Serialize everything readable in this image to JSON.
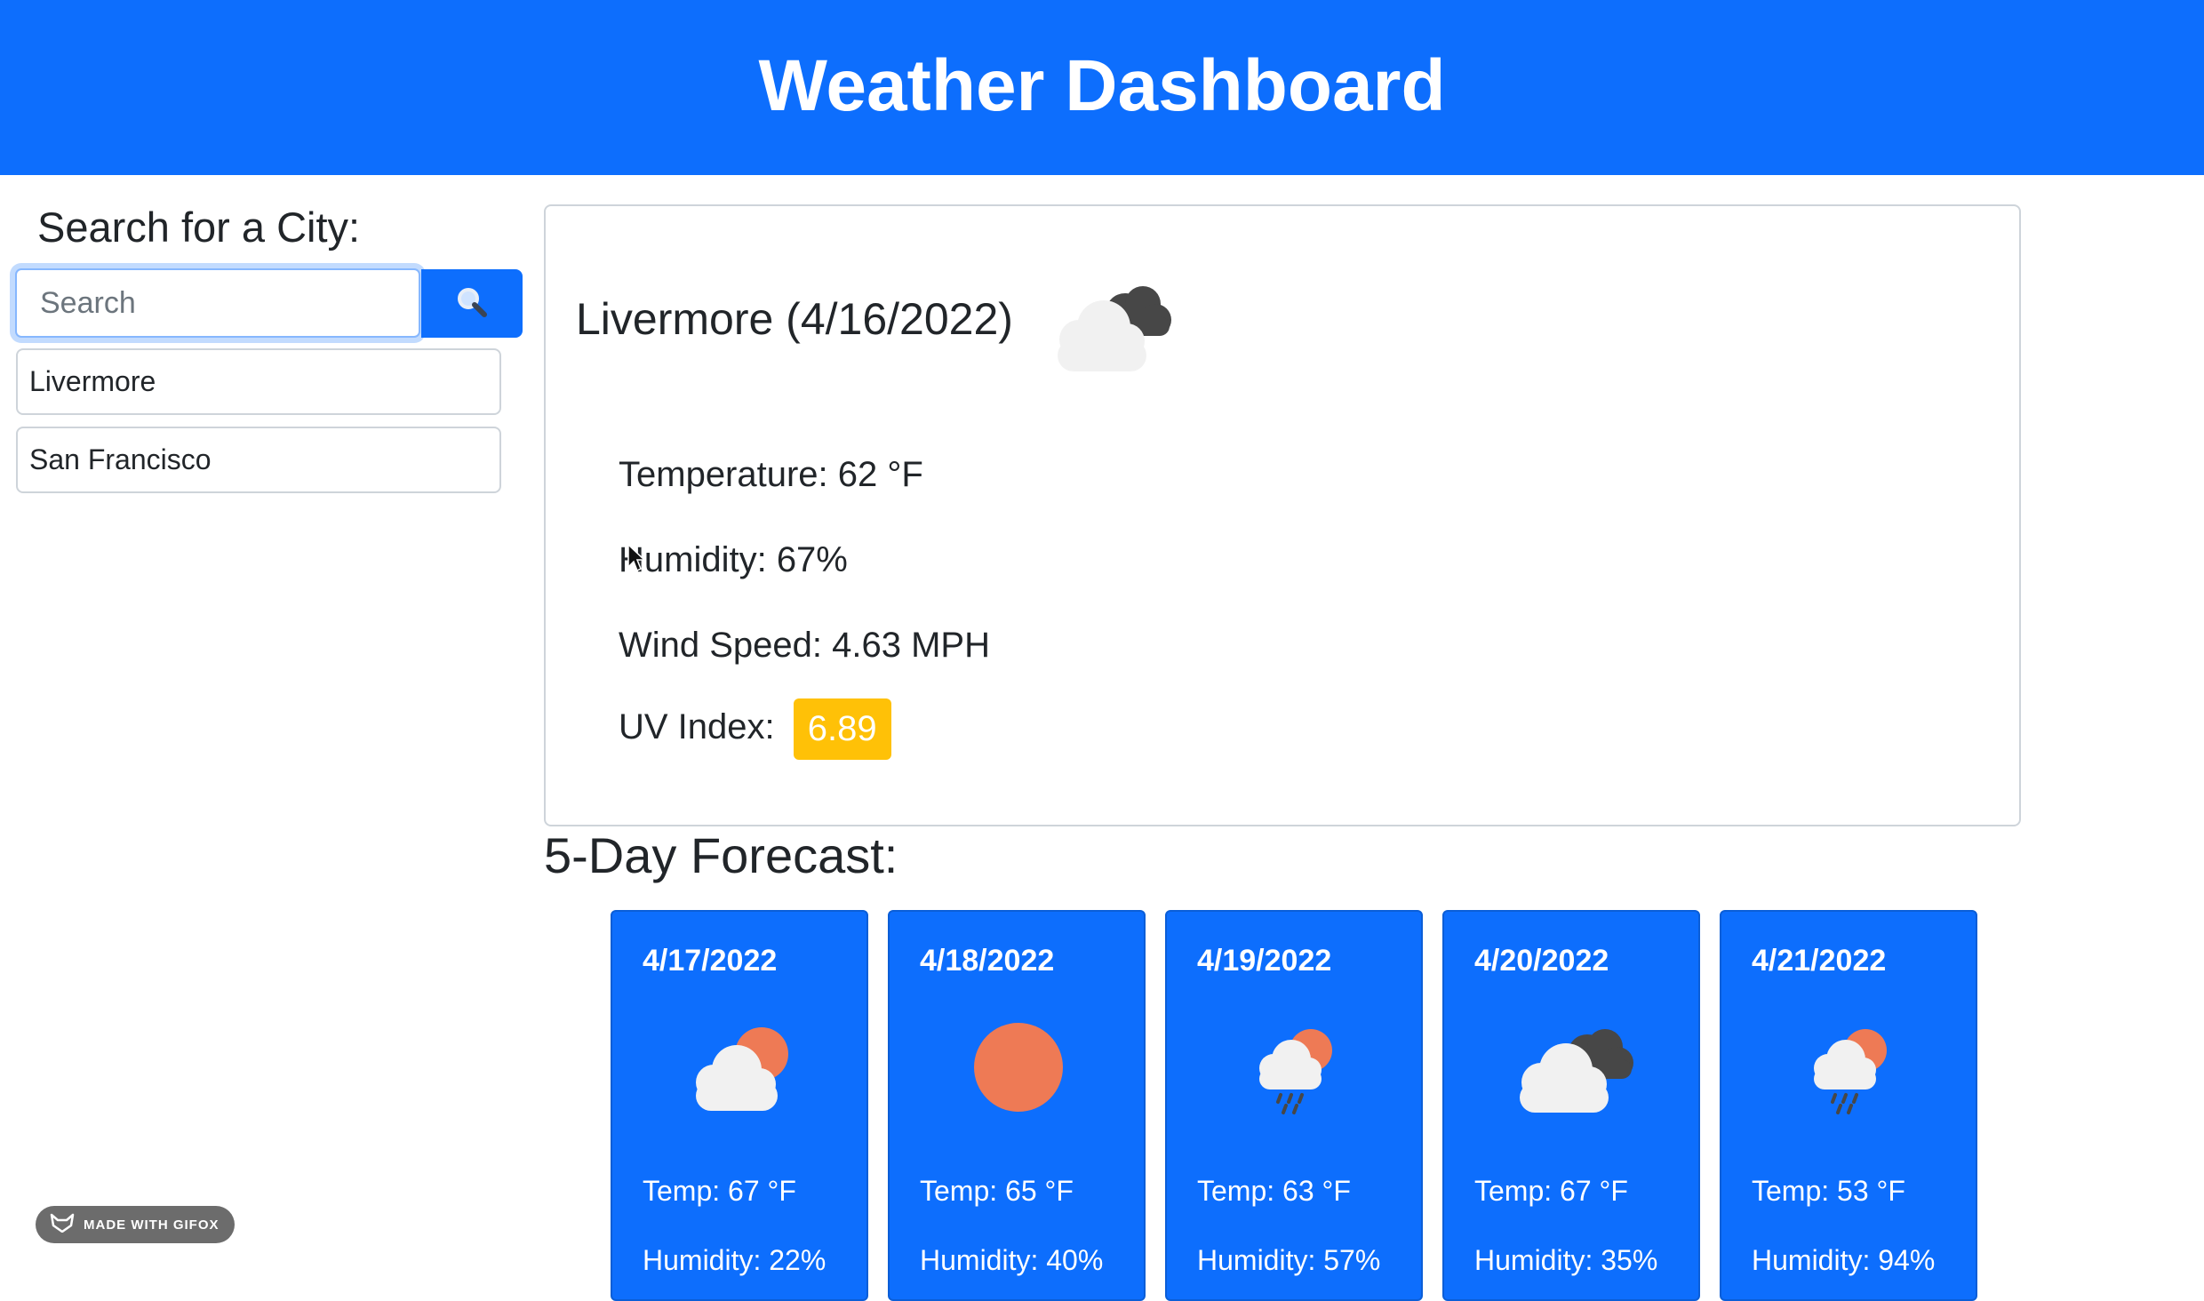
{
  "header": {
    "title": "Weather Dashboard"
  },
  "search": {
    "title": "Search for a City:",
    "placeholder": "Search",
    "button_icon": "search-icon"
  },
  "history": [
    "Livermore",
    "San Francisco"
  ],
  "current": {
    "city_date": "Livermore (4/16/2022)",
    "icon": "broken-clouds-icon",
    "temperature": "Temperature: 62 °F",
    "humidity": "Humidity: 67%",
    "wind": "Wind Speed: 4.63 MPH",
    "uv_label": "UV Index:",
    "uv_value": "6.89",
    "uv_color": "#ffc107"
  },
  "forecast": {
    "title": "5-Day Forecast:",
    "days": [
      {
        "date": "4/17/2022",
        "icon": "few-clouds-icon",
        "temp": "Temp: 67 °F",
        "humidity": "Humidity: 22%"
      },
      {
        "date": "4/18/2022",
        "icon": "clear-sun-icon",
        "temp": "Temp: 65 °F",
        "humidity": "Humidity: 40%"
      },
      {
        "date": "4/19/2022",
        "icon": "rain-sun-icon",
        "temp": "Temp: 63 °F",
        "humidity": "Humidity: 57%"
      },
      {
        "date": "4/20/2022",
        "icon": "broken-clouds-icon",
        "temp": "Temp: 67 °F",
        "humidity": "Humidity: 35%"
      },
      {
        "date": "4/21/2022",
        "icon": "rain-sun-icon",
        "temp": "Temp: 53 °F",
        "humidity": "Humidity: 94%"
      }
    ]
  },
  "watermark": {
    "text": "MADE WITH GIFOX"
  },
  "colors": {
    "primary": "#0d6efd",
    "uv_warning": "#ffc107",
    "sun": "#ee7a55"
  }
}
